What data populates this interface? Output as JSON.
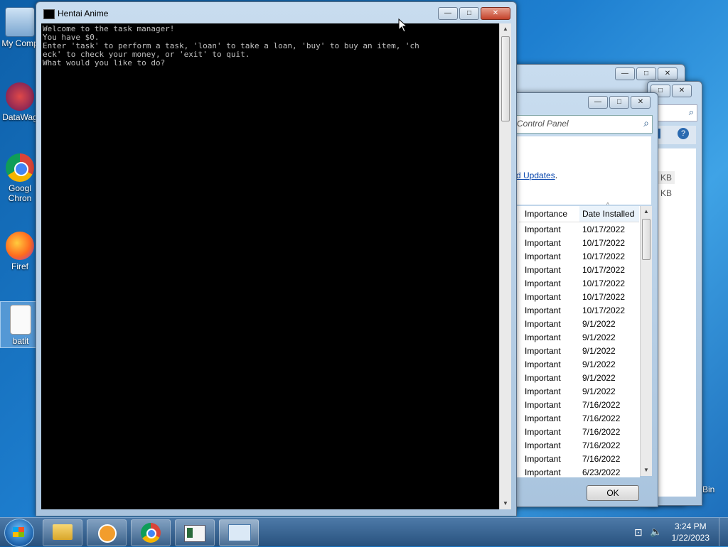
{
  "desktop": {
    "icons": [
      {
        "label": "My Comp",
        "icon": "computer-icon"
      },
      {
        "label": "DataWag",
        "icon": "datawag-shortcut-icon"
      },
      {
        "label": "Googl Chron",
        "icon": "chrome-shortcut-icon"
      },
      {
        "label": "Firef",
        "icon": "firefox-shortcut-icon"
      },
      {
        "label": "batit",
        "icon": "text-file-icon"
      }
    ],
    "recycle_bin_label": "Bin"
  },
  "console": {
    "title": "Hentai Anime",
    "lines": [
      "Welcome to the task manager!",
      "You have $0.",
      "Enter 'task' to perform a task, 'loan' to take a loan, 'buy' to buy an item, 'ch",
      "eck' to check your money, or 'exit' to quit.",
      "What would you like to do?"
    ],
    "buttons": {
      "minimize": "—",
      "maximize": "□",
      "close": "✕"
    }
  },
  "updates_window": {
    "search_placeholder": "Control Panel",
    "link_text": "d Updates",
    "link_suffix": ".",
    "kb_labels": [
      "KB",
      "KB"
    ],
    "columns": [
      "Importance",
      "Date Installed"
    ],
    "rows": [
      [
        "Important",
        "10/17/2022"
      ],
      [
        "Important",
        "10/17/2022"
      ],
      [
        "Important",
        "10/17/2022"
      ],
      [
        "Important",
        "10/17/2022"
      ],
      [
        "Important",
        "10/17/2022"
      ],
      [
        "Important",
        "10/17/2022"
      ],
      [
        "Important",
        "10/17/2022"
      ],
      [
        "Important",
        "9/1/2022"
      ],
      [
        "Important",
        "9/1/2022"
      ],
      [
        "Important",
        "9/1/2022"
      ],
      [
        "Important",
        "9/1/2022"
      ],
      [
        "Important",
        "9/1/2022"
      ],
      [
        "Important",
        "9/1/2022"
      ],
      [
        "Important",
        "7/16/2022"
      ],
      [
        "Important",
        "7/16/2022"
      ],
      [
        "Important",
        "7/16/2022"
      ],
      [
        "Important",
        "7/16/2022"
      ],
      [
        "Important",
        "7/16/2022"
      ],
      [
        "Important",
        "6/23/2022"
      ]
    ],
    "ok_label": "OK"
  },
  "taskbar": {
    "time": "3:24 PM",
    "date": "1/22/2023",
    "pinned": [
      "explorer-icon",
      "media-player-icon",
      "chrome-icon",
      "console-app-icon",
      "control-panel-icon"
    ]
  }
}
